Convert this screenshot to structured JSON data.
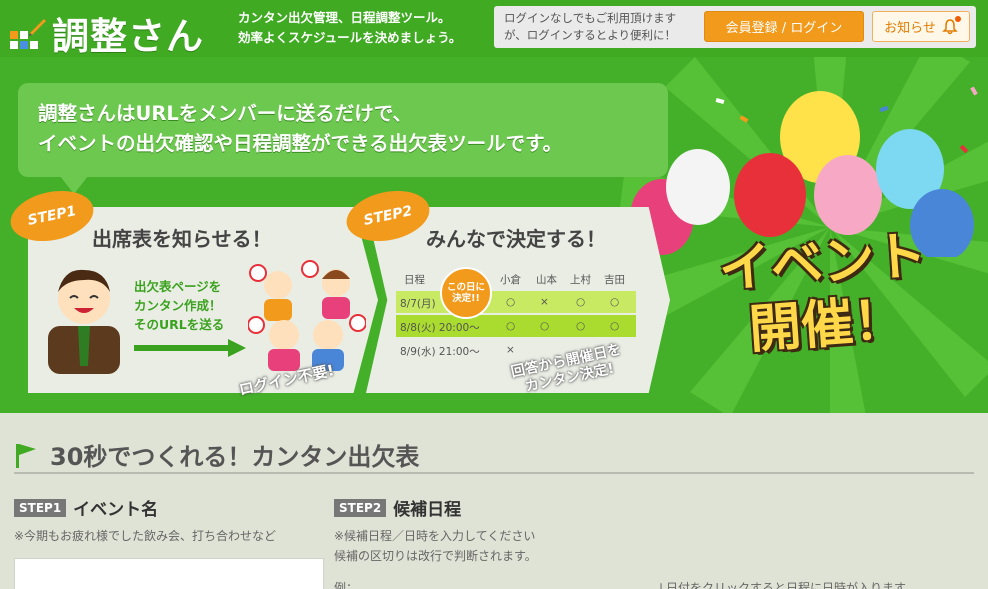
{
  "header": {
    "logo_text": "調整さん",
    "tagline_line1": "カンタン出欠管理、日程調整ツール。",
    "tagline_line2": "効率よくスケジュールを決めましょう。",
    "notice_line1": "ログインなしでもご利用頂けます",
    "notice_line2": "が、ログインするとより便利に！",
    "login_button": "会員登録 / ログイン",
    "news_button": "お知らせ"
  },
  "hero": {
    "intro_line1": "調整さんはURLをメンバーに送るだけで、",
    "intro_line2": "イベントの出欠確認や日程調整ができる出欠表ツールです。",
    "step1": {
      "badge": "STEP1",
      "heading": "出席表を知らせる！",
      "note_line1": "出欠表ページを",
      "note_line2": "カンタン作成！",
      "note_line3": "そのURLを送る",
      "stamp": "ログイン不要!"
    },
    "step2": {
      "badge": "STEP2",
      "heading": "みんなで決定する！",
      "stamp_line1": "回答から開催日を",
      "stamp_line2": "カンタン決定!",
      "decide_line1": "この日に",
      "decide_line2": "決定!!",
      "table": {
        "date_header": "日程",
        "names": [
          "小倉",
          "山本",
          "上村",
          "吉田"
        ],
        "rows": [
          {
            "date": "8/7(月)",
            "marks": [
              "○",
              "×",
              "○",
              "○"
            ]
          },
          {
            "date": "8/8(火) 20:00～",
            "marks": [
              "○",
              "○",
              "○",
              "○"
            ]
          },
          {
            "date": "8/9(水) 21:00～",
            "marks": [
              "×",
              "",
              "",
              ""
            ]
          }
        ]
      }
    },
    "event_line1": "イベント",
    "event_line2": "開催！"
  },
  "main": {
    "section_title": "30秒でつくれる！カンタン出欠表",
    "step1_tag": "STEP1",
    "step1_label": "イベント名",
    "step1_hint": "※今期もお疲れ様でした飲み会、打ち合わせなど",
    "step2_tag": "STEP2",
    "step2_label": "候補日程",
    "step2_hint_line1": "※候補日程／日時を入力してください",
    "step2_hint_line2": "候補の区切りは改行で判断されます。",
    "example_label": "例：",
    "calendar_hint": "↓日付をクリックすると日程に日時が入ります"
  },
  "colors": {
    "brand_green": "#3faa22",
    "accent_orange": "#f29a1c",
    "background": "#dfe3d6"
  }
}
